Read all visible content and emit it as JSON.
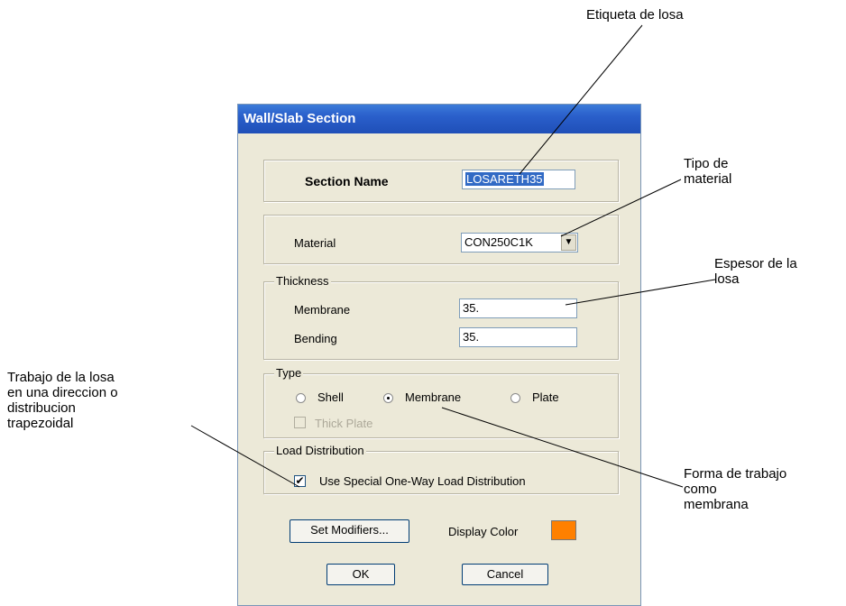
{
  "annotations": {
    "slab_label": "Etiqueta de losa",
    "material_type": "Tipo de\nmaterial",
    "thickness": "Espesor de la\nlosa",
    "one_way": "Trabajo de la losa\nen una direccion o\ndistribucion\ntrapezoidal",
    "membrane_work": "Forma de trabajo\ncomo\nmembrana"
  },
  "dialog": {
    "title": "Wall/Slab Section",
    "section_name_label": "Section Name",
    "section_name_value": "LOSARETH35",
    "material_label": "Material",
    "material_value": "CON250C1K",
    "thickness_group": "Thickness",
    "membrane_label": "Membrane",
    "membrane_value": "35.",
    "bending_label": "Bending",
    "bending_value": "35.",
    "type_group": "Type",
    "type_options": [
      "Shell",
      "Membrane",
      "Plate"
    ],
    "type_selected": "Membrane",
    "thick_plate_label": "Thick Plate",
    "load_group": "Load Distribution",
    "one_way_label": "Use Special One-Way Load Distribution",
    "one_way_checked": true,
    "set_modifiers_label": "Set Modifiers...",
    "display_color_label": "Display Color",
    "display_color": "#ff8000",
    "ok_label": "OK",
    "cancel_label": "Cancel"
  }
}
